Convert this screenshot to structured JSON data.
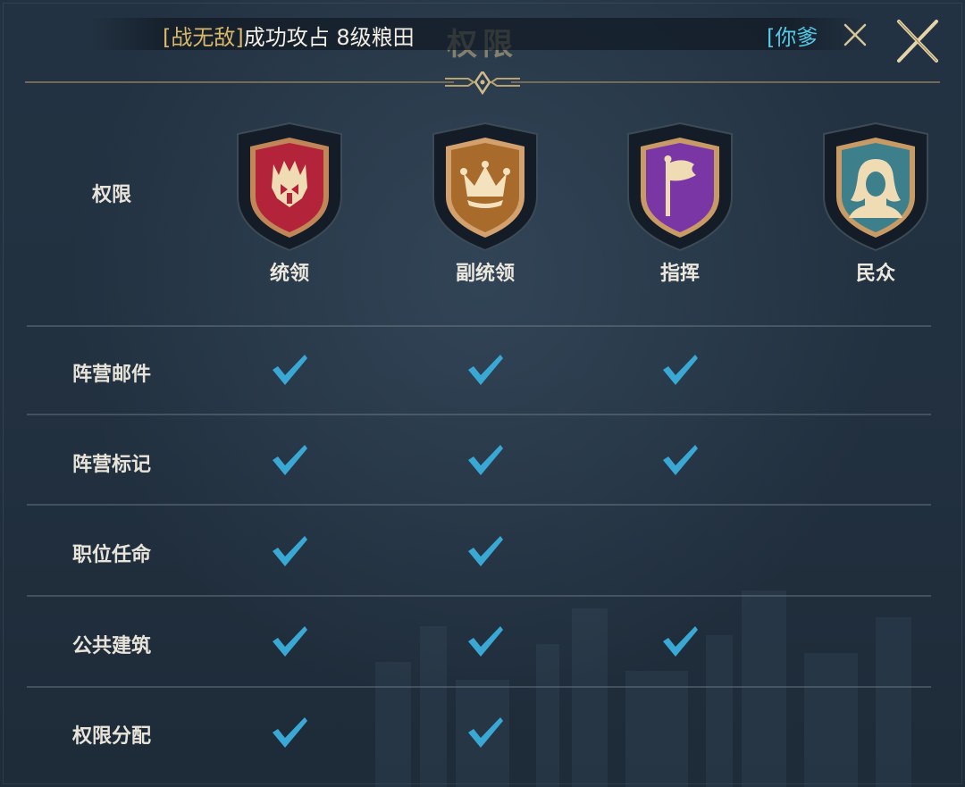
{
  "dialog": {
    "title": "权限",
    "close_icon": "close-icon"
  },
  "broadcast": {
    "tag": "[战无敌]",
    "message": "成功攻占 8级粮田",
    "next_tag": "[你爹",
    "dismiss_icon": "close-icon"
  },
  "header": {
    "label": "权限",
    "roles": [
      {
        "name": "统领",
        "icon": "commander-helmet-icon",
        "color": "#b3243a"
      },
      {
        "name": "副统领",
        "icon": "crown-icon",
        "color": "#a86b2c"
      },
      {
        "name": "指挥",
        "icon": "flag-icon",
        "color": "#7b36a6"
      },
      {
        "name": "民众",
        "icon": "citizen-icon",
        "color": "#3e7f8c"
      }
    ]
  },
  "permissions": [
    {
      "name": "阵营邮件",
      "allowed": [
        true,
        true,
        true,
        false
      ]
    },
    {
      "name": "阵营标记",
      "allowed": [
        true,
        true,
        true,
        false
      ]
    },
    {
      "name": "职位任命",
      "allowed": [
        true,
        true,
        false,
        false
      ]
    },
    {
      "name": "公共建筑",
      "allowed": [
        true,
        true,
        true,
        false
      ]
    },
    {
      "name": "权限分配",
      "allowed": [
        true,
        true,
        false,
        false
      ]
    }
  ],
  "colors": {
    "check": "#3aa8d4",
    "gold": "#cfb98a"
  }
}
